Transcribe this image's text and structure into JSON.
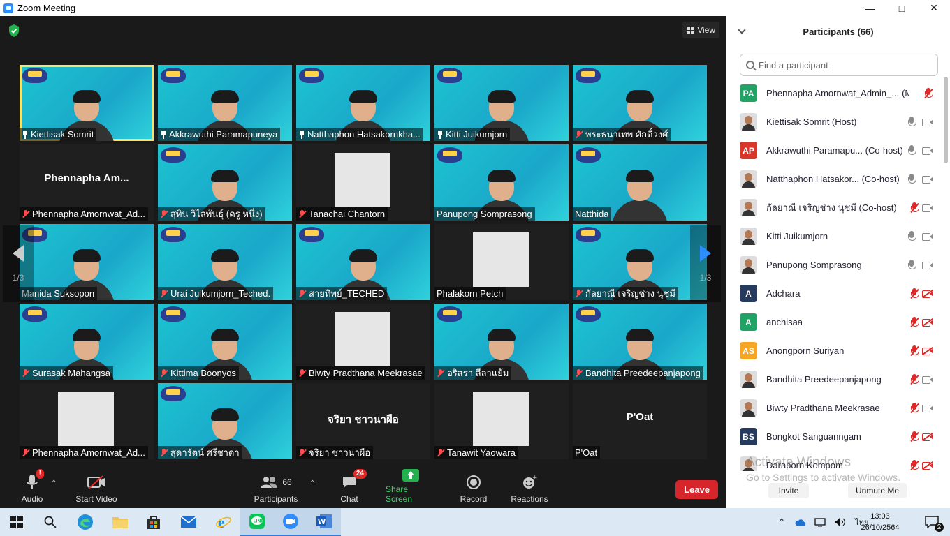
{
  "window": {
    "title": "Zoom Meeting"
  },
  "view_label": "View",
  "tiles": [
    {
      "name": "Kiettisak Somrit",
      "icon": "pin",
      "bg": "teal",
      "active": true
    },
    {
      "name": "Akkrawuthi Paramapuneya",
      "icon": "pin",
      "bg": "teal"
    },
    {
      "name": "Natthaphon Hatsakornkha...",
      "icon": "pin",
      "bg": "teal"
    },
    {
      "name": "Kitti Juikumjorn",
      "icon": "pin",
      "bg": "teal"
    },
    {
      "name": "พระธนาเทพ ศักดิ์วงศ์",
      "icon": "muted",
      "bg": "teal"
    },
    {
      "name": "Phennapha Amornwat_Ad...",
      "icon": "muted",
      "bg": "dark",
      "bigname": "Phennapha  Am..."
    },
    {
      "name": "สุทิน วิไลพันธุ์ (ครู หนึ่ง)",
      "icon": "muted",
      "bg": "teal"
    },
    {
      "name": "Tanachai Chantorn",
      "icon": "muted",
      "bg": "dark"
    },
    {
      "name": "Panupong Somprasong",
      "icon": "none",
      "bg": "teal"
    },
    {
      "name": "Natthida",
      "icon": "none",
      "bg": "teal"
    },
    {
      "name": "Manida Suksopon",
      "icon": "none",
      "bg": "teal"
    },
    {
      "name": "Urai Juikumjorn_Teched.",
      "icon": "muted",
      "bg": "teal"
    },
    {
      "name": "สายทิพย์_TECHED",
      "icon": "muted",
      "bg": "teal"
    },
    {
      "name": "Phalakorn Petch",
      "icon": "none",
      "bg": "dark"
    },
    {
      "name": "กัลยาณี เจริญช่าง นุชมี",
      "icon": "muted",
      "bg": "teal"
    },
    {
      "name": "Surasak Mahangsa",
      "icon": "muted",
      "bg": "teal"
    },
    {
      "name": "Kittima Boonyos",
      "icon": "muted",
      "bg": "teal"
    },
    {
      "name": "Biwty Pradthana Meekrasae",
      "icon": "muted",
      "bg": "dark"
    },
    {
      "name": "อริสรา ลีลาแย้ม",
      "icon": "muted",
      "bg": "teal"
    },
    {
      "name": "Bandhita Preedeepanjapong",
      "icon": "muted",
      "bg": "teal"
    },
    {
      "name": "Phennapha Amornwat_Ad...",
      "icon": "muted",
      "bg": "dark"
    },
    {
      "name": "สุดารัตน์ ศรีชาดา",
      "icon": "muted",
      "bg": "teal"
    },
    {
      "name": "จริยา ชาวนาผือ",
      "icon": "muted",
      "bg": "dark",
      "bigname": "จริยา ชาวนาผือ"
    },
    {
      "name": "Tanawit Yaowara",
      "icon": "muted",
      "bg": "dark"
    },
    {
      "name": "P'Oat",
      "icon": "none",
      "bg": "dark",
      "bigname": "P'Oat"
    }
  ],
  "pager": {
    "left": "1/3",
    "right": "1/3"
  },
  "toolbar": {
    "audio": "Audio",
    "audio_badge": "!",
    "video": "Start Video",
    "participants": "Participants",
    "participants_count": "66",
    "chat": "Chat",
    "chat_badge": "24",
    "share": "Share Screen",
    "record": "Record",
    "reactions": "Reactions",
    "leave": "Leave"
  },
  "panel": {
    "title": "Participants (66)",
    "search_placeholder": "Find a participant",
    "participants": [
      {
        "initials": "PA",
        "color": "#21a366",
        "name": "Phennapha Amornwat_Admin_...",
        "suffix": "(Me)",
        "mic": "muted",
        "cam": "none"
      },
      {
        "initials": "",
        "color": "",
        "name": "Kiettisak Somrit (Host)",
        "mic": "on",
        "cam": "on"
      },
      {
        "initials": "AP",
        "color": "#d9362b",
        "name": "Akkrawuthi Paramapu... (Co-host)",
        "mic": "on",
        "cam": "on"
      },
      {
        "initials": "",
        "color": "",
        "name": "Natthaphon Hatsakor... (Co-host)",
        "mic": "on",
        "cam": "on"
      },
      {
        "initials": "",
        "color": "",
        "name": "กัลยาณี เจริญช่าง นุชมี (Co-host)",
        "mic": "muted",
        "cam": "on"
      },
      {
        "initials": "",
        "color": "",
        "name": "Kitti Juikumjorn",
        "mic": "on",
        "cam": "on"
      },
      {
        "initials": "",
        "color": "",
        "name": "Panupong Somprasong",
        "mic": "on",
        "cam": "on"
      },
      {
        "initials": "A",
        "color": "#263a5e",
        "name": "Adchara",
        "mic": "muted",
        "cam": "off"
      },
      {
        "initials": "A",
        "color": "#21a366",
        "name": "anchisaa",
        "mic": "muted",
        "cam": "off"
      },
      {
        "initials": "AS",
        "color": "#f5a623",
        "name": "Anongporn Suriyan",
        "mic": "muted",
        "cam": "off"
      },
      {
        "initials": "",
        "color": "",
        "name": "Bandhita Preedeepanjapong",
        "mic": "muted",
        "cam": "on"
      },
      {
        "initials": "",
        "color": "",
        "name": "Biwty Pradthana Meekrasae",
        "mic": "muted",
        "cam": "on"
      },
      {
        "initials": "BS",
        "color": "#263a5e",
        "name": "Bongkot Sanguanngam",
        "mic": "muted",
        "cam": "off"
      },
      {
        "initials": "",
        "color": "",
        "name": "Daraporn Kompom",
        "mic": "muted",
        "cam": "off"
      }
    ],
    "invite": "Invite",
    "unmute_me": "Unmute Me"
  },
  "watermark": {
    "line1": "Activate Windows",
    "line2": "Go to Settings to activate Windows."
  },
  "taskbar": {
    "time": "13:03",
    "date": "26/10/2564",
    "lang": "ไทย",
    "notifications": "2"
  }
}
